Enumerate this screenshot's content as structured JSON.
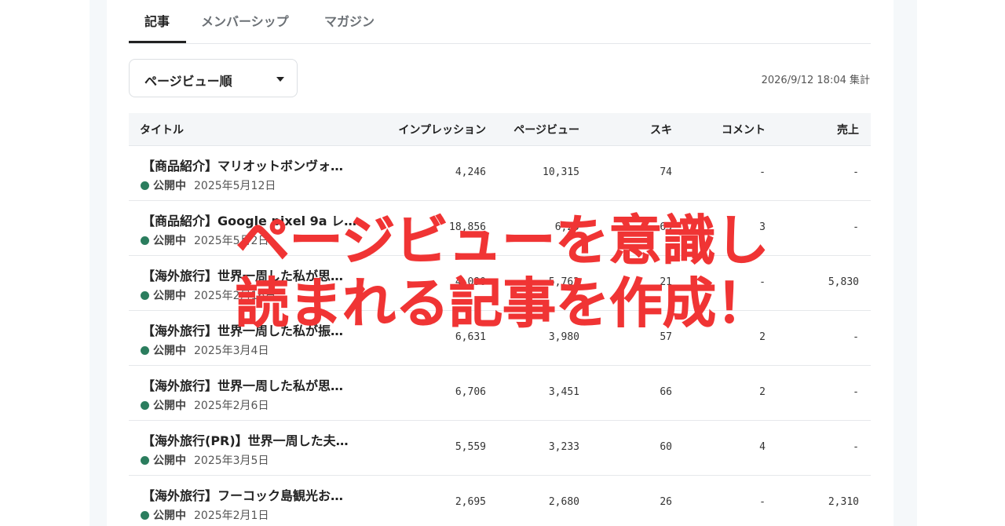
{
  "tabs": [
    {
      "label": "記事",
      "active": true
    },
    {
      "label": "メンバーシップ",
      "active": false
    },
    {
      "label": "マガジン",
      "active": false
    }
  ],
  "sort": {
    "selected": "ページビュー順"
  },
  "aggregated_at": "2026/9/12 18:04 集計",
  "table": {
    "headers": {
      "title": "タイトル",
      "impressions": "インプレッション",
      "pageviews": "ページビュー",
      "likes": "スキ",
      "comments": "コメント",
      "sales": "売上"
    },
    "rows": [
      {
        "title": "【商品紹介】マリオットボンヴォ…",
        "status": "公開中",
        "date": "2025年5月12日",
        "impressions": "4,246",
        "pageviews": "10,315",
        "likes": "74",
        "comments": "-",
        "sales": "-"
      },
      {
        "title": "【商品紹介】Google pixel 9a レ…",
        "status": "公開中",
        "date": "2025年5月2日",
        "impressions": "18,856",
        "pageviews": "6,29",
        "likes": "63",
        "comments": "3",
        "sales": "-"
      },
      {
        "title": "【海外旅行】世界一周した私が思…",
        "status": "公開中",
        "date": "2025年2月16日",
        "impressions": "4,090",
        "pageviews": "5,762",
        "likes": "21",
        "comments": "-",
        "sales": "5,830"
      },
      {
        "title": "【海外旅行】世界一周した私が振…",
        "status": "公開中",
        "date": "2025年3月4日",
        "impressions": "6,631",
        "pageviews": "3,980",
        "likes": "57",
        "comments": "2",
        "sales": "-"
      },
      {
        "title": "【海外旅行】世界一周した私が思…",
        "status": "公開中",
        "date": "2025年2月6日",
        "impressions": "6,706",
        "pageviews": "3,451",
        "likes": "66",
        "comments": "2",
        "sales": "-"
      },
      {
        "title": "【海外旅行(PR)】世界一周した夫…",
        "status": "公開中",
        "date": "2025年3月5日",
        "impressions": "5,559",
        "pageviews": "3,233",
        "likes": "60",
        "comments": "4",
        "sales": "-"
      },
      {
        "title": "【海外旅行】フーコック島観光お…",
        "status": "公開中",
        "date": "2025年2月1日",
        "impressions": "2,695",
        "pageviews": "2,680",
        "likes": "26",
        "comments": "-",
        "sales": "2,310"
      }
    ]
  },
  "overlay": {
    "line1": "ページビューを意識し",
    "line2": "読まれる記事を作成！"
  },
  "colors": {
    "accent_overlay": "#f03434",
    "status_dot": "#2b7d5e"
  }
}
